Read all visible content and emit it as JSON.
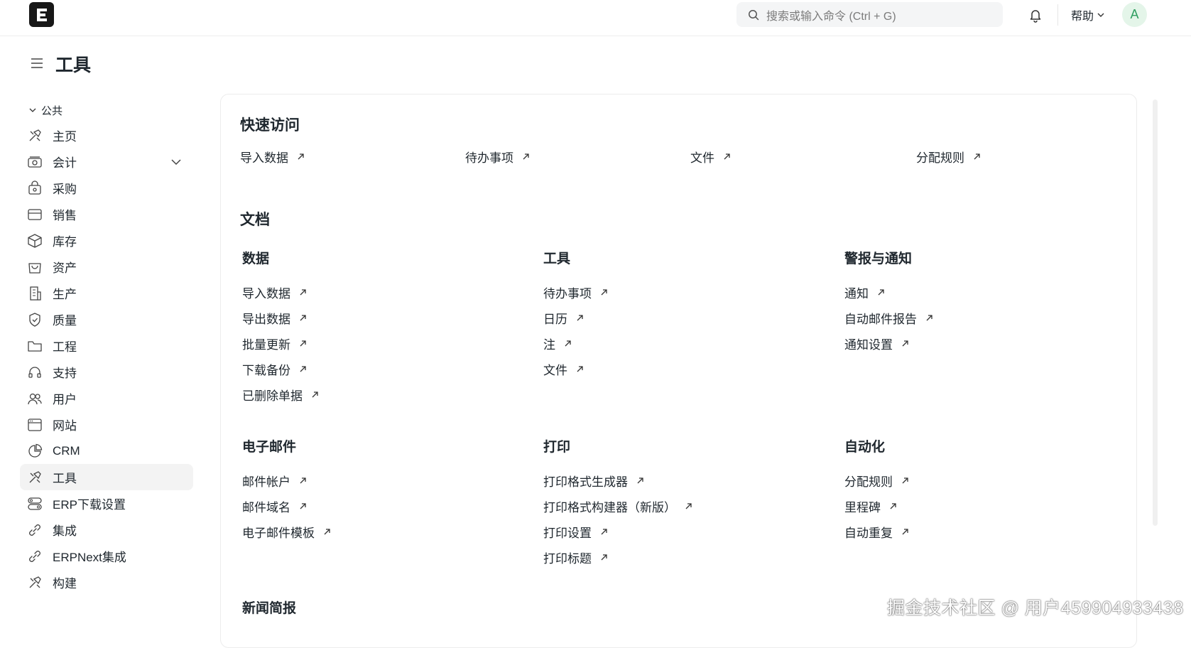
{
  "header": {
    "logo_letter": "E",
    "search_placeholder": "搜索或输入命令 (Ctrl + G)",
    "help_label": "帮助",
    "avatar_letter": "A"
  },
  "page": {
    "title": "工具"
  },
  "sidebar": {
    "section_label": "公共",
    "items": [
      {
        "label": "主页",
        "icon": "tools-icon"
      },
      {
        "label": "会计",
        "icon": "accounting-icon",
        "expandable": true
      },
      {
        "label": "采购",
        "icon": "buying-icon"
      },
      {
        "label": "销售",
        "icon": "selling-icon"
      },
      {
        "label": "库存",
        "icon": "stock-icon"
      },
      {
        "label": "资产",
        "icon": "assets-icon"
      },
      {
        "label": "生产",
        "icon": "building-icon"
      },
      {
        "label": "质量",
        "icon": "quality-icon"
      },
      {
        "label": "工程",
        "icon": "folder-icon"
      },
      {
        "label": "支持",
        "icon": "headset-icon"
      },
      {
        "label": "用户",
        "icon": "users-icon"
      },
      {
        "label": "网站",
        "icon": "website-icon"
      },
      {
        "label": "CRM",
        "icon": "crm-icon"
      },
      {
        "label": "工具",
        "icon": "tools-icon",
        "active": true
      },
      {
        "label": "ERP下载设置",
        "icon": "settings-icon"
      },
      {
        "label": "集成",
        "icon": "integration-icon"
      },
      {
        "label": "ERPNext集成",
        "icon": "integration-icon"
      },
      {
        "label": "构建",
        "icon": "tools-icon"
      }
    ]
  },
  "quick_access": {
    "title": "快速访问",
    "links": [
      "导入数据",
      "待办事项",
      "文件",
      "分配规则"
    ]
  },
  "documents": {
    "title": "文档",
    "groups": [
      {
        "title": "数据",
        "links": [
          "导入数据",
          "导出数据",
          "批量更新",
          "下载备份",
          "已删除单据"
        ]
      },
      {
        "title": "工具",
        "links": [
          "待办事项",
          "日历",
          "注",
          "文件"
        ]
      },
      {
        "title": "警报与通知",
        "links": [
          "通知",
          "自动邮件报告",
          "通知设置"
        ]
      },
      {
        "title": "电子邮件",
        "links": [
          "邮件帐户",
          "邮件域名",
          "电子邮件模板"
        ]
      },
      {
        "title": "打印",
        "links": [
          "打印格式生成器",
          "打印格式构建器（新版）",
          "打印设置",
          "打印标题"
        ]
      },
      {
        "title": "自动化",
        "links": [
          "分配规则",
          "里程碑",
          "自动重复"
        ]
      },
      {
        "title": "新闻简报",
        "links": []
      }
    ]
  },
  "watermark": "掘金技术社区 @ 用户459904933438"
}
